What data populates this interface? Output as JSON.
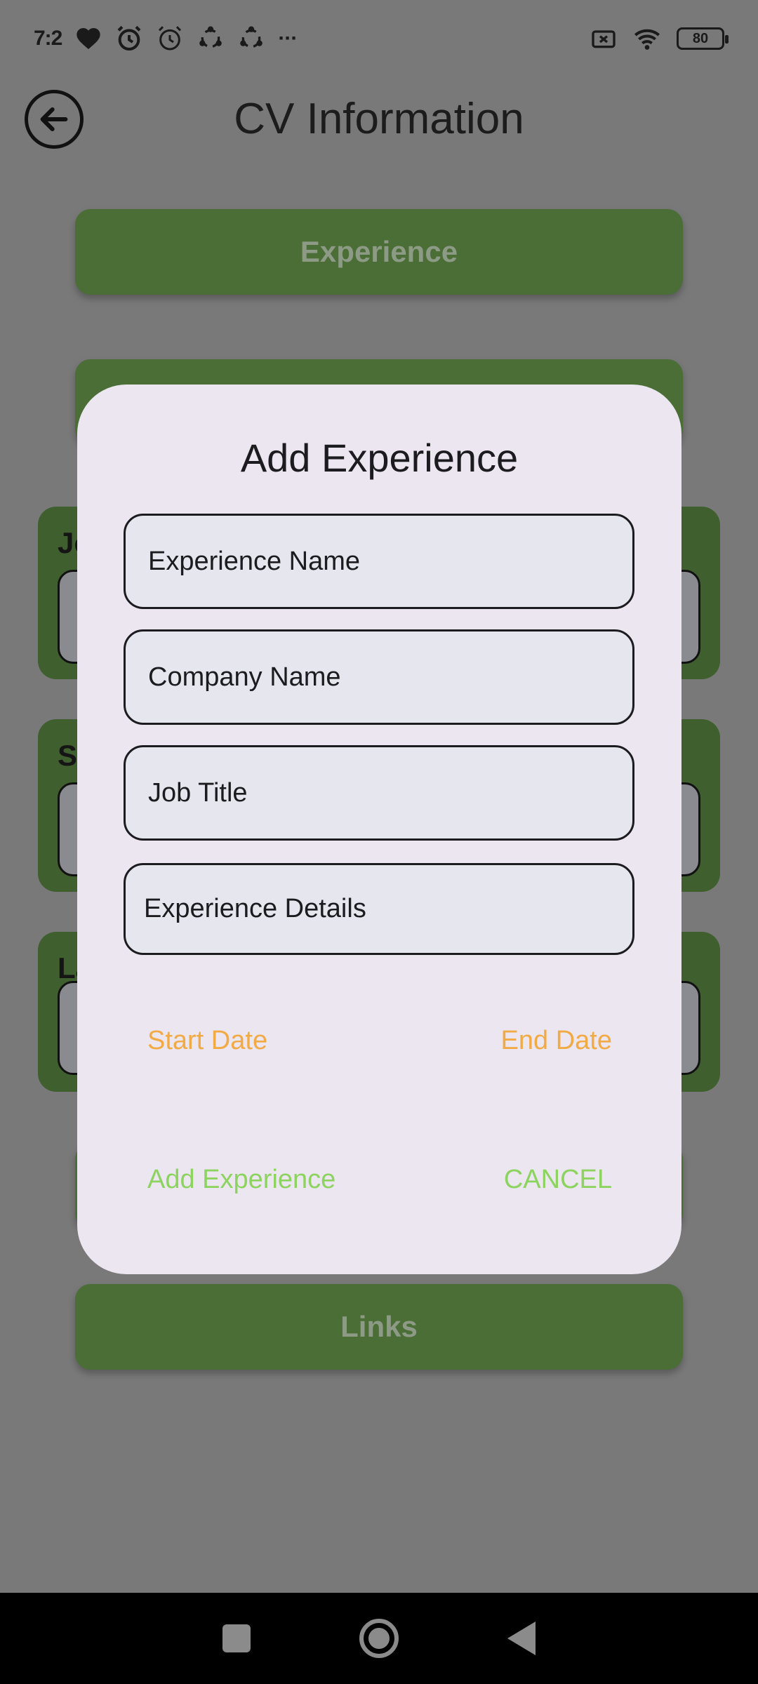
{
  "status_bar": {
    "time": "7:2",
    "more": "···",
    "battery": "80",
    "icons": [
      "heart-icon",
      "alarm-icon",
      "alarm-icon",
      "sync-icon",
      "sync-icon",
      "sim-off-icon",
      "wifi-icon",
      "battery-icon"
    ]
  },
  "header": {
    "title": "CV Information",
    "back_icon": "arrow-left-circle-icon"
  },
  "background": {
    "experience_button": "Experience",
    "links_button": "Links",
    "sections": [
      {
        "label": "Jo"
      },
      {
        "label": "S"
      },
      {
        "label": "La"
      }
    ]
  },
  "dialog": {
    "title": "Add Experience",
    "fields": [
      {
        "label": "Experience Name"
      },
      {
        "label": "Company Name"
      },
      {
        "label": "Job Title"
      },
      {
        "label": "Experience Details"
      }
    ],
    "start_date": "Start Date",
    "end_date": "End Date",
    "add_button": "Add Experience",
    "cancel_button": "CANCEL"
  },
  "colors": {
    "green_button": "#4a6e36",
    "green_section": "#3f5f2f",
    "dialog_bg": "#ece6f1",
    "date_text": "#f2aa45",
    "action_text": "#8dd35f"
  }
}
